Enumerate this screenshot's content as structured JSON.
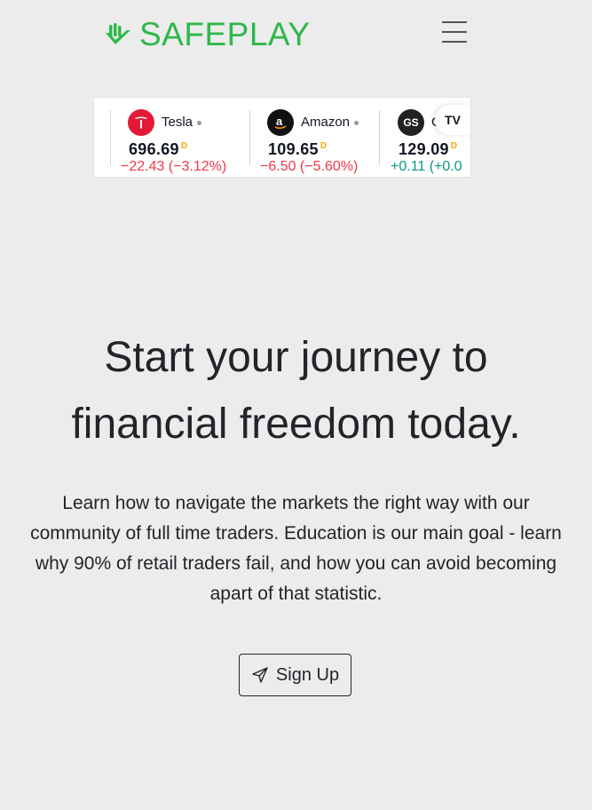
{
  "brand": {
    "name": "SAFEPLAY",
    "color": "#2eb84b",
    "icon": "hand-chart-icon"
  },
  "nav": {
    "menu_icon": "hamburger-menu-icon"
  },
  "ticker": {
    "badge": "TV",
    "items": [
      {
        "name": "Tesla",
        "price": "696.69",
        "flag": "D",
        "change": "−22.43 (−3.12%)",
        "trend": "negative",
        "logo": "tesla-logo-icon"
      },
      {
        "name": "Amazon",
        "price": "109.65",
        "flag": "D",
        "change": "−6.50 (−5.60%)",
        "trend": "negative",
        "logo": "amazon-logo-icon"
      },
      {
        "name": "G",
        "price": "129.09",
        "flag": "D",
        "change": "+0.11 (+0.0",
        "trend": "positive",
        "logo": "gs-logo-icon",
        "logo_text": "GS"
      }
    ]
  },
  "hero": {
    "title_line1": "Start your journey to",
    "title_line2": "financial freedom today.",
    "text": "Learn how to navigate the markets the right way with our community of full time traders. Education is our main goal - learn why 90% of retail traders fail, and how you can avoid becoming apart of that statistic.",
    "cta_label": "Sign Up",
    "cta_icon": "send-icon"
  },
  "colors": {
    "background": "#ececec",
    "negative": "#f23645",
    "positive": "#089981"
  }
}
